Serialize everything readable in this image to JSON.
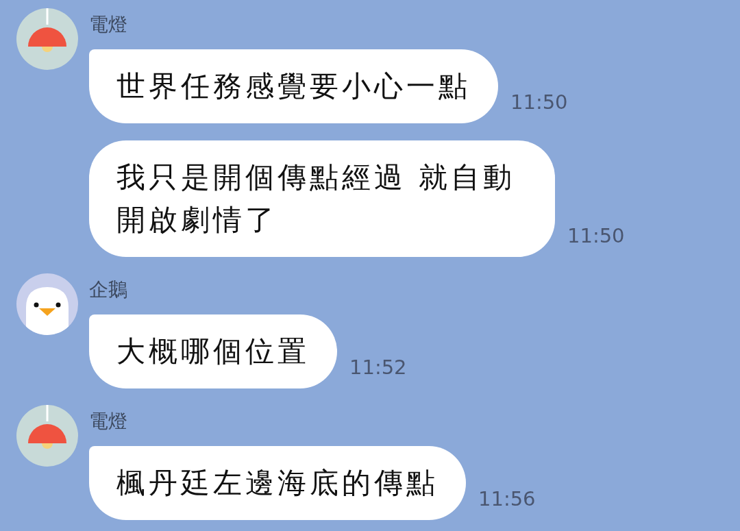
{
  "messages_groups": [
    {
      "sender": "電燈",
      "kind": "lamp",
      "messages": [
        {
          "text": "世界任務感覺要小心一點",
          "time": "11:50"
        },
        {
          "text": "我只是開個傳點經過 就自動開啟劇情了",
          "time": "11:50"
        }
      ]
    },
    {
      "sender": "企鵝",
      "kind": "penguin",
      "messages": [
        {
          "text": "大概哪個位置",
          "time": "11:52"
        }
      ]
    },
    {
      "sender": "電燈",
      "kind": "lamp",
      "messages": [
        {
          "text": "楓丹廷左邊海底的傳點",
          "time": "11:56"
        }
      ]
    }
  ]
}
